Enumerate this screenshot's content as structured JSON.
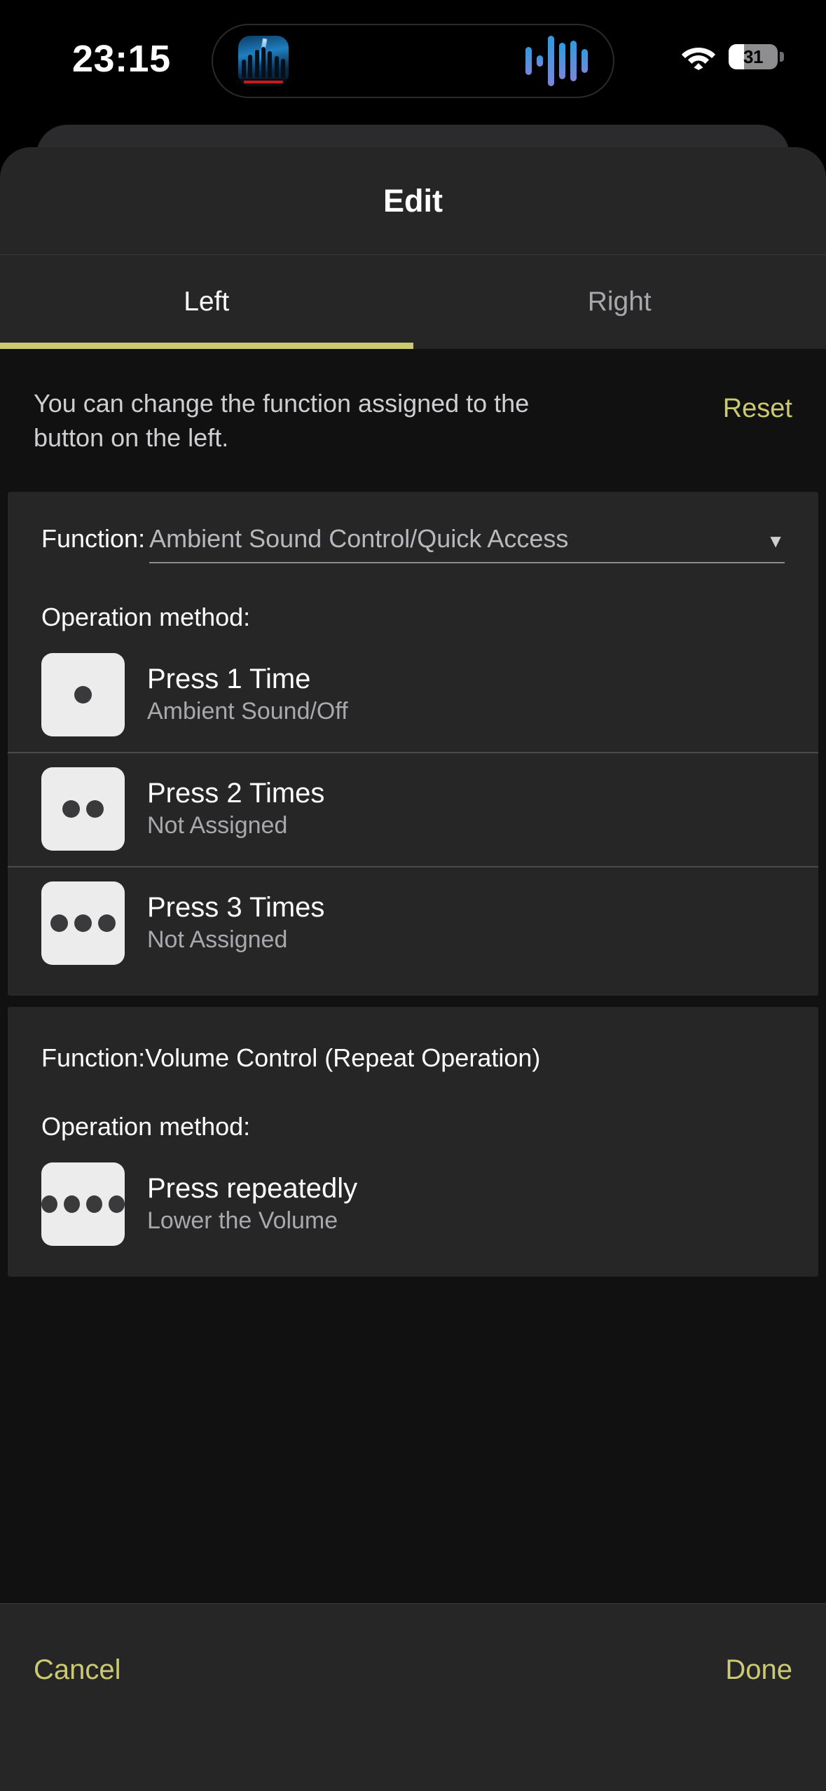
{
  "status_bar": {
    "time": "23:15",
    "wifi_icon": "wifi-icon",
    "battery_percent": "31",
    "battery_level": 31
  },
  "dynamic_island": {
    "album_art_icon": "album-art",
    "waveform_icon": "audio-waveform-icon"
  },
  "modal": {
    "title": "Edit",
    "tabs": [
      {
        "label": "Left",
        "active": true
      },
      {
        "label": "Right",
        "active": false
      }
    ],
    "intro": {
      "text": "You can change the function assigned to the button on the left.",
      "reset_label": "Reset"
    },
    "sections": [
      {
        "function_label": "Function:",
        "function_value": "Ambient Sound Control/Quick Access",
        "caret_icon": "chevron-down-icon",
        "operation_label": "Operation method:",
        "rows": [
          {
            "dots": 1,
            "title": "Press 1 Time",
            "subtitle": "Ambient Sound/Off"
          },
          {
            "dots": 2,
            "title": "Press 2 Times",
            "subtitle": "Not Assigned"
          },
          {
            "dots": 3,
            "title": "Press 3 Times",
            "subtitle": "Not Assigned"
          }
        ]
      },
      {
        "function_plain": "Function:Volume Control (Repeat Operation)",
        "operation_label": "Operation method:",
        "rows": [
          {
            "dots": 4,
            "title": "Press repeatedly",
            "subtitle": "Lower the Volume"
          }
        ]
      }
    ],
    "bottom_bar": {
      "cancel_label": "Cancel",
      "done_label": "Done"
    }
  },
  "colors": {
    "accent": "#ccca70",
    "sheet_bg": "#262627",
    "page_bg": "#111112",
    "icon_bg": "#ececed"
  }
}
